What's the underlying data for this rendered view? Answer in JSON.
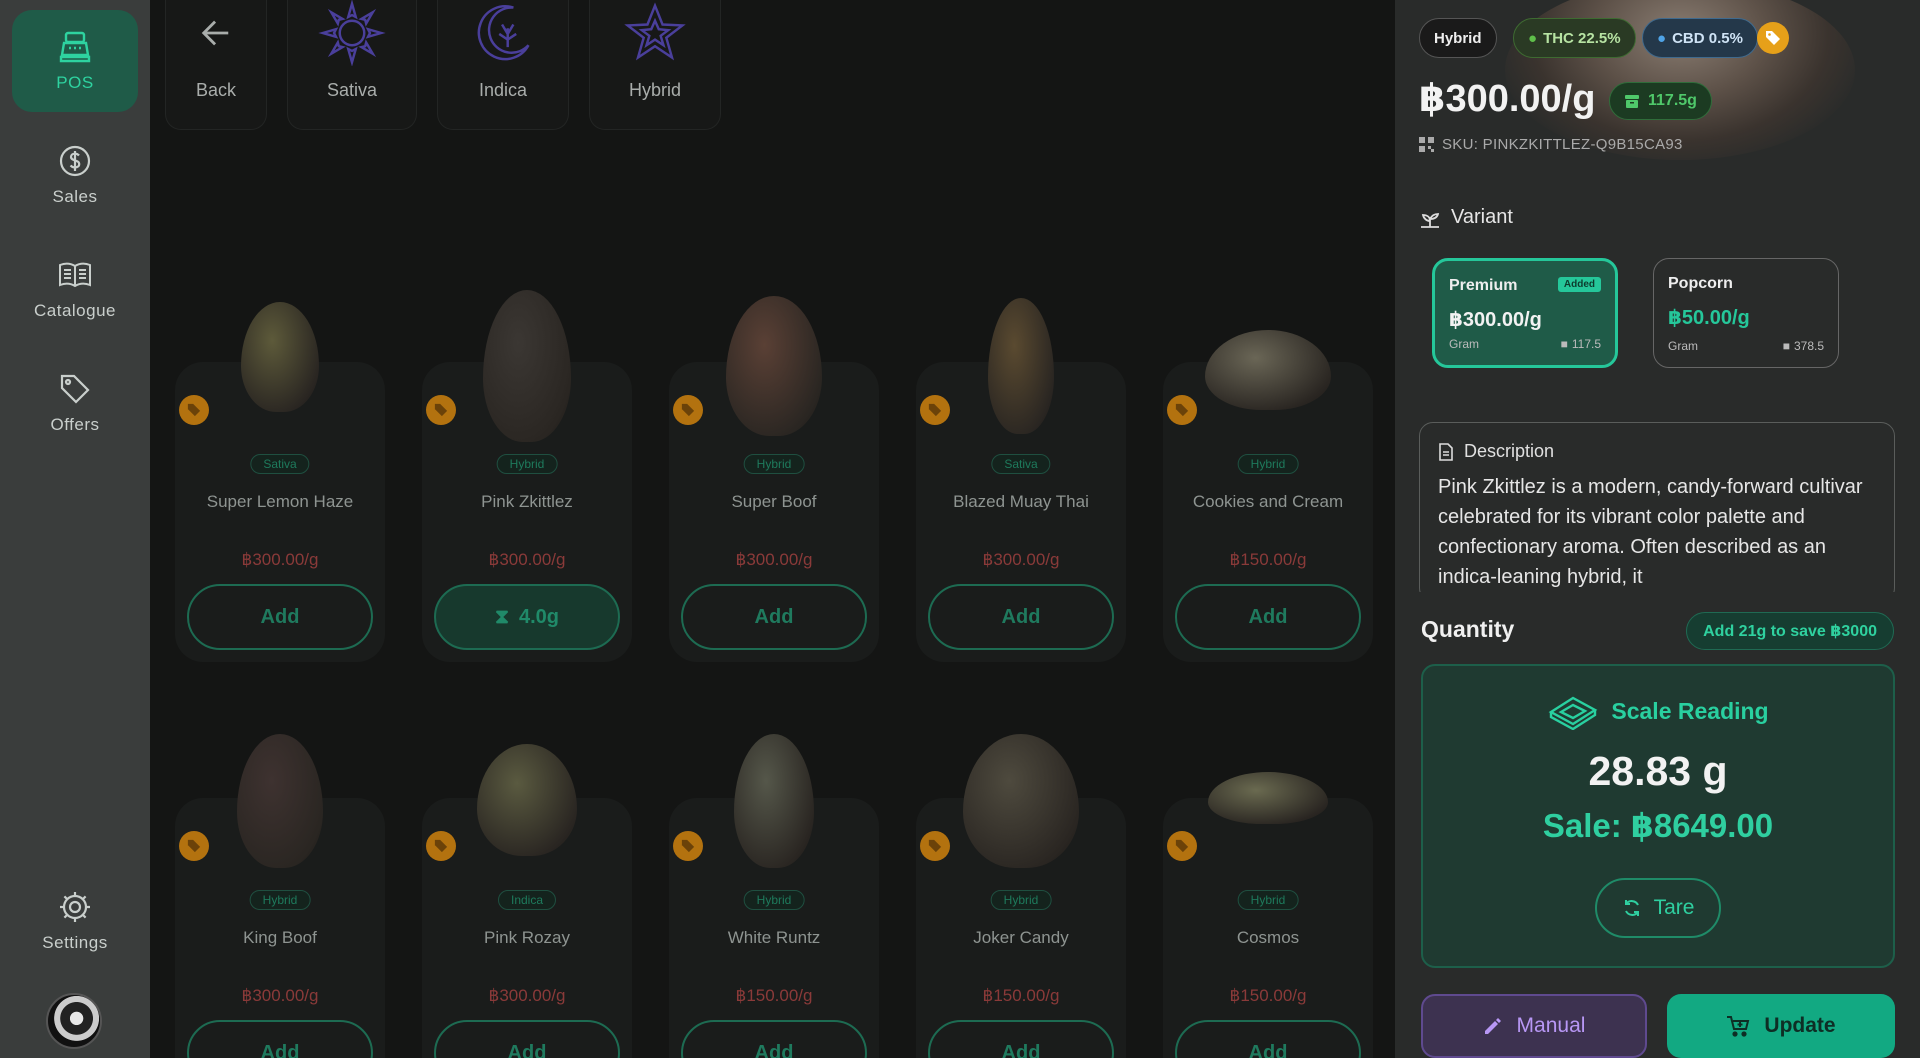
{
  "sidebar": {
    "items": [
      {
        "label": "POS",
        "icon": "register-icon",
        "active": true
      },
      {
        "label": "Sales",
        "icon": "dollar-icon"
      },
      {
        "label": "Catalogue",
        "icon": "book-icon"
      },
      {
        "label": "Offers",
        "icon": "tag-icon"
      },
      {
        "label": "Settings",
        "icon": "gear-icon"
      }
    ]
  },
  "filters": [
    {
      "label": "Back",
      "icon": "arrow-left-icon"
    },
    {
      "label": "Sativa",
      "icon": "sun-icon"
    },
    {
      "label": "Indica",
      "icon": "moon-leaf-icon"
    },
    {
      "label": "Hybrid",
      "icon": "star-icon"
    }
  ],
  "products": [
    {
      "name": "Super Lemon Haze",
      "strain": "Sativa",
      "price": "฿300.00/g",
      "action": "Add",
      "color": "#5d5a3a"
    },
    {
      "name": "Pink Zkittlez",
      "strain": "Hybrid",
      "price": "฿300.00/g",
      "action": "4.0g",
      "weighed": true,
      "color": "#3b3733"
    },
    {
      "name": "Super Boof",
      "strain": "Hybrid",
      "price": "฿300.00/g",
      "action": "Add",
      "color": "#5a4035"
    },
    {
      "name": "Blazed Muay Thai",
      "strain": "Sativa",
      "price": "฿300.00/g",
      "action": "Add",
      "color": "#5a4a30"
    },
    {
      "name": "Cookies and Cream",
      "strain": "Hybrid",
      "price": "฿150.00/g",
      "action": "Add",
      "color": "#6a6656"
    },
    {
      "name": "King Boof",
      "strain": "Hybrid",
      "price": "฿300.00/g",
      "action": "Add",
      "color": "#3e3230"
    },
    {
      "name": "Pink Rozay",
      "strain": "Indica",
      "price": "฿300.00/g",
      "action": "Add",
      "color": "#5a5a40"
    },
    {
      "name": "White Runtz",
      "strain": "Hybrid",
      "price": "฿150.00/g",
      "action": "Add",
      "color": "#55574a"
    },
    {
      "name": "Joker Candy",
      "strain": "Hybrid",
      "price": "฿150.00/g",
      "action": "Add",
      "color": "#4e4a3e"
    },
    {
      "name": "Cosmos",
      "strain": "Hybrid",
      "price": "฿150.00/g",
      "action": "Add",
      "color": "#6a6a50"
    }
  ],
  "detail": {
    "type": "Hybrid",
    "thc": "THC 22.5%",
    "cbd": "CBD 0.5%",
    "price": "฿300.00/g",
    "stock": "117.5g",
    "sku": "SKU: PINKZKITTLEZ-Q9B15CA93",
    "variant_title": "Variant",
    "variants": [
      {
        "name": "Premium",
        "price": "฿300.00/g",
        "unit": "Gram",
        "stock": "117.5",
        "badge": "Added",
        "selected": true
      },
      {
        "name": "Popcorn",
        "price": "฿50.00/g",
        "unit": "Gram",
        "stock": "378.5"
      }
    ],
    "description_title": "Description",
    "description": "Pink Zkittlez is a modern, candy-forward cultivar celebrated for its vibrant color palette and confectionary aroma. Often described as an indica-leaning hybrid, it",
    "quantity_title": "Quantity",
    "save_hint": "Add 21g to save ฿3000",
    "scale_title": "Scale Reading",
    "weight": "28.83 g",
    "sale": "Sale: ฿8649.00",
    "tare": "Tare",
    "manual": "Manual",
    "update": "Update"
  },
  "colors": {
    "accent": "#25c79a",
    "sidebar": "#3a3d3c",
    "price_red": "#8a3a39",
    "purple": "#b897f5"
  }
}
